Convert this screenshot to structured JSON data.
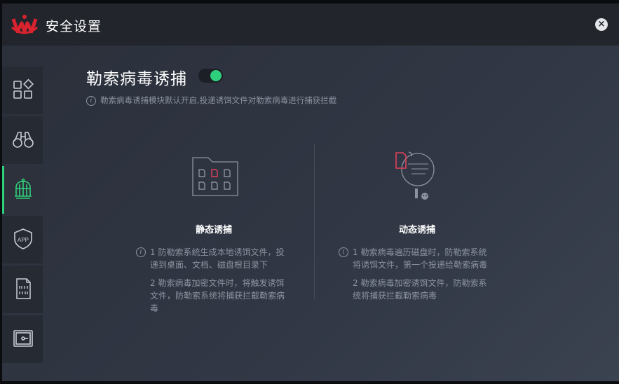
{
  "window": {
    "title": "安全设置",
    "close_symbol": "×"
  },
  "sidebar": {
    "items": [
      {
        "name": "apps",
        "icon": "apps-grid-icon"
      },
      {
        "name": "binoculars",
        "icon": "binoculars-icon"
      },
      {
        "name": "trap",
        "icon": "birdcage-icon",
        "active": true
      },
      {
        "name": "app-shield",
        "icon": "app-shield-icon",
        "label": "APP"
      },
      {
        "name": "binary-file",
        "icon": "binary-file-icon"
      },
      {
        "name": "vault",
        "icon": "safe-icon"
      }
    ]
  },
  "main": {
    "heading": "勒索病毒诱捕",
    "toggle_on": true,
    "info_text": "勒索病毒诱捕模块默认开启,投递诱饵文件对勒索病毒进行捕获拦截",
    "cards": [
      {
        "title": "静态诱捕",
        "icon": "folder-files-icon",
        "lines": [
          "1 防勒索系统生成本地诱饵文件，投递到桌面、文档、磁盘根目录下",
          "2 勒索病毒加密文件时，将触发诱饵文件，防勒索系统将捕获拦截勒索病毒"
        ]
      },
      {
        "title": "动态诱捕",
        "icon": "magnifier-virus-icon",
        "lines": [
          "1 勒索病毒遍历磁盘时，防勒索系统将诱饵文件，第一个投递给勒索病毒",
          "2 勒索病毒加密诱饵文件，防勒索系统将捕获拦截勒索病毒"
        ]
      }
    ]
  },
  "colors": {
    "accent": "#2fd07b",
    "alert": "#e0405a",
    "logo": "#d9232e"
  }
}
